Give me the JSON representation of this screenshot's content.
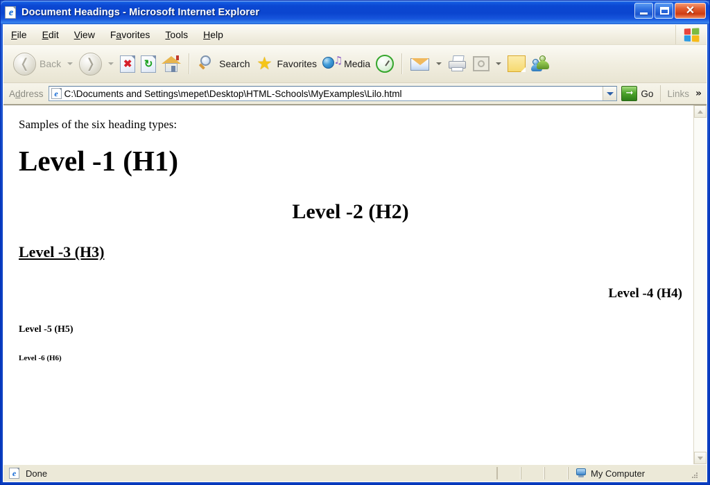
{
  "window": {
    "title_main": "Document Headings",
    "title_sep": " - ",
    "title_app": "Microsoft Internet Explorer",
    "icon": "ie-document-icon",
    "controls": {
      "minimize": "minimize-button",
      "restore": "restore-button",
      "close": "close-button",
      "close_glyph": "✕"
    },
    "accent_title_blue": "#0b45cf",
    "accent_close_red": "#cf3c12",
    "chrome_background": "#ece9d8"
  },
  "menu": {
    "items": [
      {
        "label": "File",
        "accel": "F",
        "pre": "",
        "post": "ile"
      },
      {
        "label": "Edit",
        "accel": "E",
        "pre": "",
        "post": "dit"
      },
      {
        "label": "View",
        "accel": "V",
        "pre": "",
        "post": "iew"
      },
      {
        "label": "Favorites",
        "accel": "a",
        "pre": "F",
        "post": "vorites"
      },
      {
        "label": "Tools",
        "accel": "T",
        "pre": "",
        "post": "ools"
      },
      {
        "label": "Help",
        "accel": "H",
        "pre": "",
        "post": "elp"
      }
    ],
    "logo": "windows-flag-logo"
  },
  "toolbar": {
    "back_label": "Back",
    "back_icon": "back-arrow-icon",
    "forward_icon": "forward-arrow-icon",
    "stop_icon": "stop-icon",
    "refresh_icon": "refresh-icon",
    "home_icon": "home-icon",
    "search_label": "Search",
    "search_icon": "search-magnifier-icon",
    "favorites_label": "Favorites",
    "favorites_icon": "favorites-star-icon",
    "media_label": "Media",
    "media_icon": "media-globe-icon",
    "history_icon": "history-icon",
    "mail_icon": "mail-icon",
    "print_icon": "print-icon",
    "edit_icon": "edit-page-icon",
    "note_icon": "note-icon",
    "messenger_icon": "messenger-people-icon"
  },
  "address": {
    "label": "Address",
    "label_accel_pre": "A",
    "label_accel": "d",
    "label_accel_post": "dress",
    "value": "C:\\Documents and Settings\\mepet\\Desktop\\HTML-Schools\\MyExamples\\Lilo.html",
    "placeholder": "",
    "site_icon": "ie-page-icon",
    "dropdown_icon": "chevron-down-icon",
    "go_label": "Go",
    "go_icon": "go-arrow-icon",
    "links_label": "Links",
    "overflow_chevron": "»"
  },
  "page": {
    "intro": "Samples of the six heading types:",
    "headings": [
      {
        "level": "h1",
        "text": "Level -1 (H1)",
        "align": "left"
      },
      {
        "level": "h2",
        "text": "Level -2 (H2)",
        "align": "center"
      },
      {
        "level": "h3",
        "text": "Level -3 (H3)",
        "align": "left"
      },
      {
        "level": "h4",
        "text": "Level -4 (H4)",
        "align": "right"
      },
      {
        "level": "h5",
        "text": "Level -5 (H5)",
        "align": "left"
      },
      {
        "level": "h6",
        "text": "Level -6 (H6)",
        "align": "left"
      }
    ]
  },
  "scrollbar": {
    "up_icon": "scroll-up-icon",
    "down_icon": "scroll-down-icon"
  },
  "statusbar": {
    "status_text": "Done",
    "status_icon": "ie-page-icon",
    "zone_text": "My Computer",
    "zone_icon": "my-computer-icon",
    "grip": "resize-grip"
  }
}
